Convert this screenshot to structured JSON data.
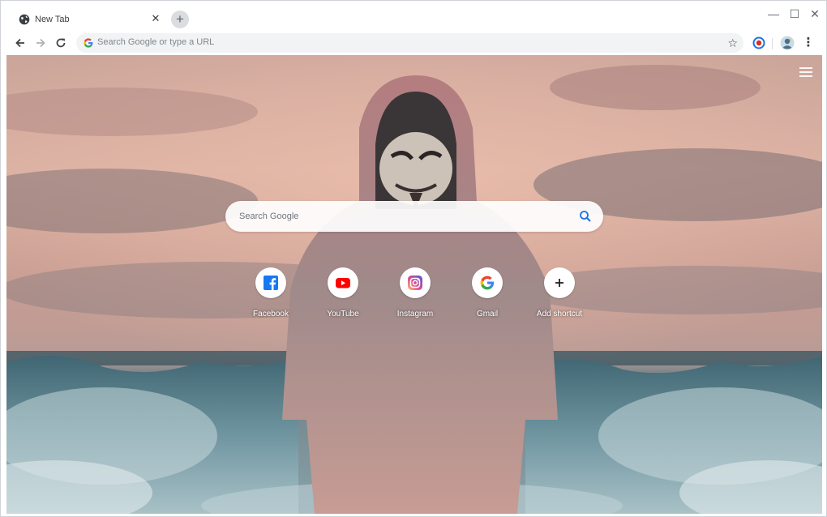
{
  "tab": {
    "title": "New Tab",
    "favicon": "globe-icon"
  },
  "window_controls": {
    "minimize": "—",
    "maximize": "☐",
    "close": "✕"
  },
  "omnibox": {
    "placeholder": "Search Google or type a URL"
  },
  "ntp": {
    "search_placeholder": "Search Google",
    "shortcuts": [
      {
        "label": "Facebook",
        "icon": "facebook-icon",
        "color": "#1877f2"
      },
      {
        "label": "YouTube",
        "icon": "youtube-icon",
        "color": "#ff0000"
      },
      {
        "label": "Instagram",
        "icon": "instagram-icon",
        "color": "#c13584"
      },
      {
        "label": "Gmail",
        "icon": "google-icon",
        "color": "#4285f4"
      },
      {
        "label": "Add shortcut",
        "icon": "plus-icon",
        "color": "#202124"
      }
    ]
  },
  "colors": {
    "accent_blue": "#1a73e8",
    "omnibox_bg": "#f1f3f4"
  }
}
